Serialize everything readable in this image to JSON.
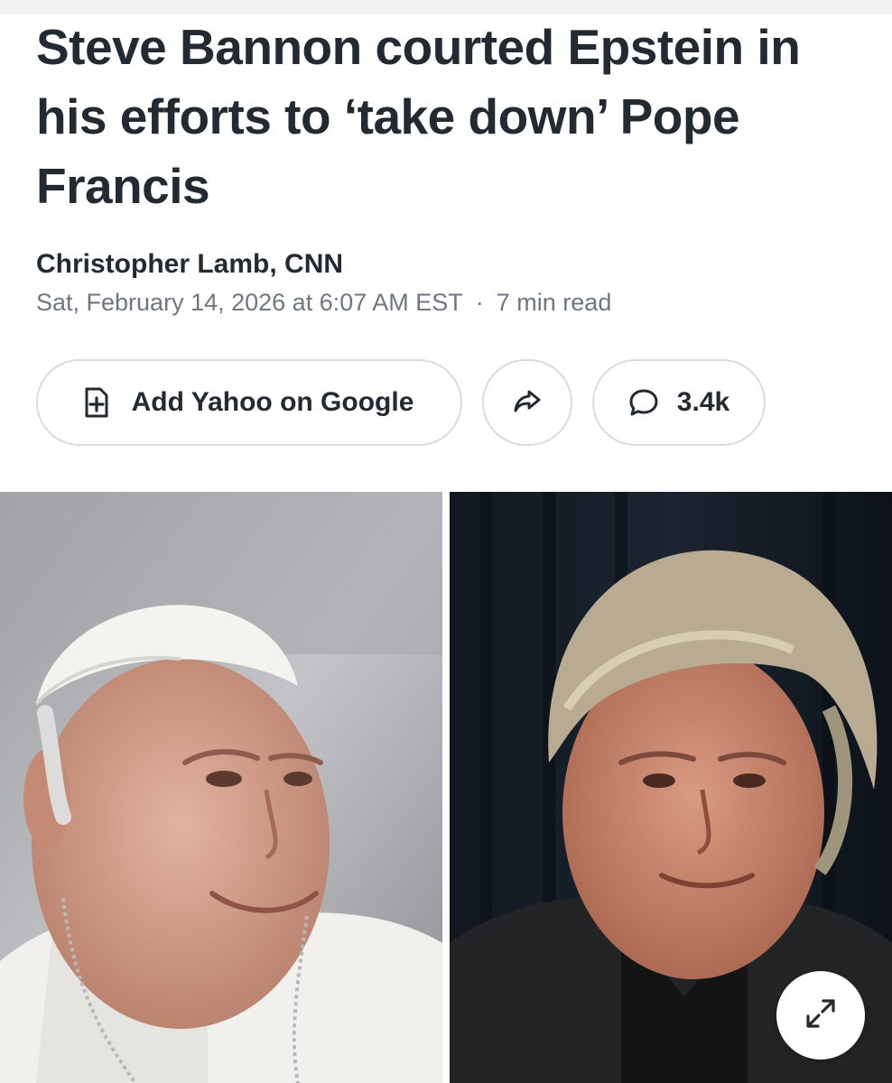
{
  "article": {
    "headline": "Steve Bannon courted Epstein in his efforts to ‘take down’ Pope Francis",
    "author": "Christopher Lamb, CNN",
    "date": "Sat, February 14, 2026 at 6:07 AM EST",
    "separator": "·",
    "read_time": "7 min read"
  },
  "actions": {
    "google_label": "Add Yahoo on Google",
    "comments_count": "3.4k",
    "icons": {
      "google": "add-document-icon",
      "share": "share-arrow-icon",
      "comments": "comment-bubble-icon"
    }
  },
  "media": {
    "left_image": "portrait-photo-pope",
    "right_image": "portrait-photo-man",
    "expand_icon": "expand-arrows-icon"
  },
  "colors": {
    "text": "#232a31",
    "muted": "#6e7780",
    "border": "#d9dcdf"
  }
}
